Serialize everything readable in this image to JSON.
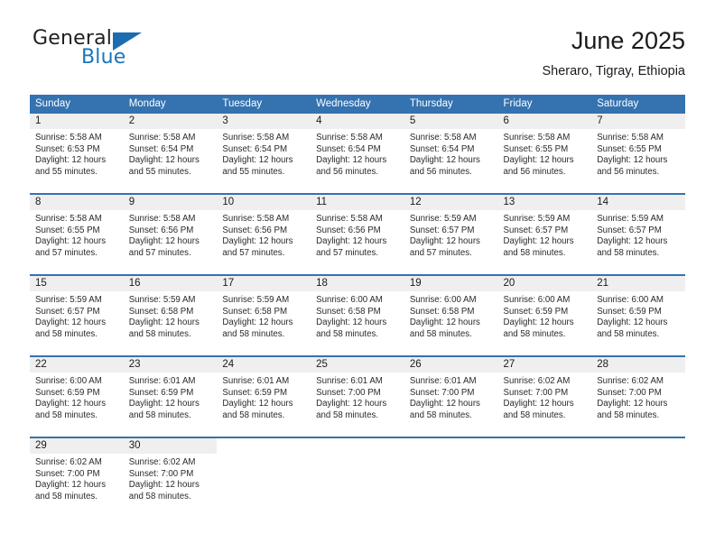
{
  "brand": {
    "name_part1": "General",
    "name_part2": "Blue",
    "logo_icon": "triangle-flag-icon"
  },
  "header": {
    "title": "June 2025",
    "location": "Sheraro, Tigray, Ethiopia"
  },
  "calendar": {
    "weekday_headers": [
      "Sunday",
      "Monday",
      "Tuesday",
      "Wednesday",
      "Thursday",
      "Friday",
      "Saturday"
    ],
    "accent_color": "#3572b0",
    "daynum_band_color": "#efefef",
    "weeks": [
      [
        {
          "day": "1",
          "sunrise": "Sunrise: 5:58 AM",
          "sunset": "Sunset: 6:53 PM",
          "daylight_line1": "Daylight: 12 hours",
          "daylight_line2": "and 55 minutes."
        },
        {
          "day": "2",
          "sunrise": "Sunrise: 5:58 AM",
          "sunset": "Sunset: 6:54 PM",
          "daylight_line1": "Daylight: 12 hours",
          "daylight_line2": "and 55 minutes."
        },
        {
          "day": "3",
          "sunrise": "Sunrise: 5:58 AM",
          "sunset": "Sunset: 6:54 PM",
          "daylight_line1": "Daylight: 12 hours",
          "daylight_line2": "and 55 minutes."
        },
        {
          "day": "4",
          "sunrise": "Sunrise: 5:58 AM",
          "sunset": "Sunset: 6:54 PM",
          "daylight_line1": "Daylight: 12 hours",
          "daylight_line2": "and 56 minutes."
        },
        {
          "day": "5",
          "sunrise": "Sunrise: 5:58 AM",
          "sunset": "Sunset: 6:54 PM",
          "daylight_line1": "Daylight: 12 hours",
          "daylight_line2": "and 56 minutes."
        },
        {
          "day": "6",
          "sunrise": "Sunrise: 5:58 AM",
          "sunset": "Sunset: 6:55 PM",
          "daylight_line1": "Daylight: 12 hours",
          "daylight_line2": "and 56 minutes."
        },
        {
          "day": "7",
          "sunrise": "Sunrise: 5:58 AM",
          "sunset": "Sunset: 6:55 PM",
          "daylight_line1": "Daylight: 12 hours",
          "daylight_line2": "and 56 minutes."
        }
      ],
      [
        {
          "day": "8",
          "sunrise": "Sunrise: 5:58 AM",
          "sunset": "Sunset: 6:55 PM",
          "daylight_line1": "Daylight: 12 hours",
          "daylight_line2": "and 57 minutes."
        },
        {
          "day": "9",
          "sunrise": "Sunrise: 5:58 AM",
          "sunset": "Sunset: 6:56 PM",
          "daylight_line1": "Daylight: 12 hours",
          "daylight_line2": "and 57 minutes."
        },
        {
          "day": "10",
          "sunrise": "Sunrise: 5:58 AM",
          "sunset": "Sunset: 6:56 PM",
          "daylight_line1": "Daylight: 12 hours",
          "daylight_line2": "and 57 minutes."
        },
        {
          "day": "11",
          "sunrise": "Sunrise: 5:58 AM",
          "sunset": "Sunset: 6:56 PM",
          "daylight_line1": "Daylight: 12 hours",
          "daylight_line2": "and 57 minutes."
        },
        {
          "day": "12",
          "sunrise": "Sunrise: 5:59 AM",
          "sunset": "Sunset: 6:57 PM",
          "daylight_line1": "Daylight: 12 hours",
          "daylight_line2": "and 57 minutes."
        },
        {
          "day": "13",
          "sunrise": "Sunrise: 5:59 AM",
          "sunset": "Sunset: 6:57 PM",
          "daylight_line1": "Daylight: 12 hours",
          "daylight_line2": "and 58 minutes."
        },
        {
          "day": "14",
          "sunrise": "Sunrise: 5:59 AM",
          "sunset": "Sunset: 6:57 PM",
          "daylight_line1": "Daylight: 12 hours",
          "daylight_line2": "and 58 minutes."
        }
      ],
      [
        {
          "day": "15",
          "sunrise": "Sunrise: 5:59 AM",
          "sunset": "Sunset: 6:57 PM",
          "daylight_line1": "Daylight: 12 hours",
          "daylight_line2": "and 58 minutes."
        },
        {
          "day": "16",
          "sunrise": "Sunrise: 5:59 AM",
          "sunset": "Sunset: 6:58 PM",
          "daylight_line1": "Daylight: 12 hours",
          "daylight_line2": "and 58 minutes."
        },
        {
          "day": "17",
          "sunrise": "Sunrise: 5:59 AM",
          "sunset": "Sunset: 6:58 PM",
          "daylight_line1": "Daylight: 12 hours",
          "daylight_line2": "and 58 minutes."
        },
        {
          "day": "18",
          "sunrise": "Sunrise: 6:00 AM",
          "sunset": "Sunset: 6:58 PM",
          "daylight_line1": "Daylight: 12 hours",
          "daylight_line2": "and 58 minutes."
        },
        {
          "day": "19",
          "sunrise": "Sunrise: 6:00 AM",
          "sunset": "Sunset: 6:58 PM",
          "daylight_line1": "Daylight: 12 hours",
          "daylight_line2": "and 58 minutes."
        },
        {
          "day": "20",
          "sunrise": "Sunrise: 6:00 AM",
          "sunset": "Sunset: 6:59 PM",
          "daylight_line1": "Daylight: 12 hours",
          "daylight_line2": "and 58 minutes."
        },
        {
          "day": "21",
          "sunrise": "Sunrise: 6:00 AM",
          "sunset": "Sunset: 6:59 PM",
          "daylight_line1": "Daylight: 12 hours",
          "daylight_line2": "and 58 minutes."
        }
      ],
      [
        {
          "day": "22",
          "sunrise": "Sunrise: 6:00 AM",
          "sunset": "Sunset: 6:59 PM",
          "daylight_line1": "Daylight: 12 hours",
          "daylight_line2": "and 58 minutes."
        },
        {
          "day": "23",
          "sunrise": "Sunrise: 6:01 AM",
          "sunset": "Sunset: 6:59 PM",
          "daylight_line1": "Daylight: 12 hours",
          "daylight_line2": "and 58 minutes."
        },
        {
          "day": "24",
          "sunrise": "Sunrise: 6:01 AM",
          "sunset": "Sunset: 6:59 PM",
          "daylight_line1": "Daylight: 12 hours",
          "daylight_line2": "and 58 minutes."
        },
        {
          "day": "25",
          "sunrise": "Sunrise: 6:01 AM",
          "sunset": "Sunset: 7:00 PM",
          "daylight_line1": "Daylight: 12 hours",
          "daylight_line2": "and 58 minutes."
        },
        {
          "day": "26",
          "sunrise": "Sunrise: 6:01 AM",
          "sunset": "Sunset: 7:00 PM",
          "daylight_line1": "Daylight: 12 hours",
          "daylight_line2": "and 58 minutes."
        },
        {
          "day": "27",
          "sunrise": "Sunrise: 6:02 AM",
          "sunset": "Sunset: 7:00 PM",
          "daylight_line1": "Daylight: 12 hours",
          "daylight_line2": "and 58 minutes."
        },
        {
          "day": "28",
          "sunrise": "Sunrise: 6:02 AM",
          "sunset": "Sunset: 7:00 PM",
          "daylight_line1": "Daylight: 12 hours",
          "daylight_line2": "and 58 minutes."
        }
      ],
      [
        {
          "day": "29",
          "sunrise": "Sunrise: 6:02 AM",
          "sunset": "Sunset: 7:00 PM",
          "daylight_line1": "Daylight: 12 hours",
          "daylight_line2": "and 58 minutes."
        },
        {
          "day": "30",
          "sunrise": "Sunrise: 6:02 AM",
          "sunset": "Sunset: 7:00 PM",
          "daylight_line1": "Daylight: 12 hours",
          "daylight_line2": "and 58 minutes."
        },
        {
          "day": "",
          "sunrise": "",
          "sunset": "",
          "daylight_line1": "",
          "daylight_line2": ""
        },
        {
          "day": "",
          "sunrise": "",
          "sunset": "",
          "daylight_line1": "",
          "daylight_line2": ""
        },
        {
          "day": "",
          "sunrise": "",
          "sunset": "",
          "daylight_line1": "",
          "daylight_line2": ""
        },
        {
          "day": "",
          "sunrise": "",
          "sunset": "",
          "daylight_line1": "",
          "daylight_line2": ""
        },
        {
          "day": "",
          "sunrise": "",
          "sunset": "",
          "daylight_line1": "",
          "daylight_line2": ""
        }
      ]
    ]
  }
}
